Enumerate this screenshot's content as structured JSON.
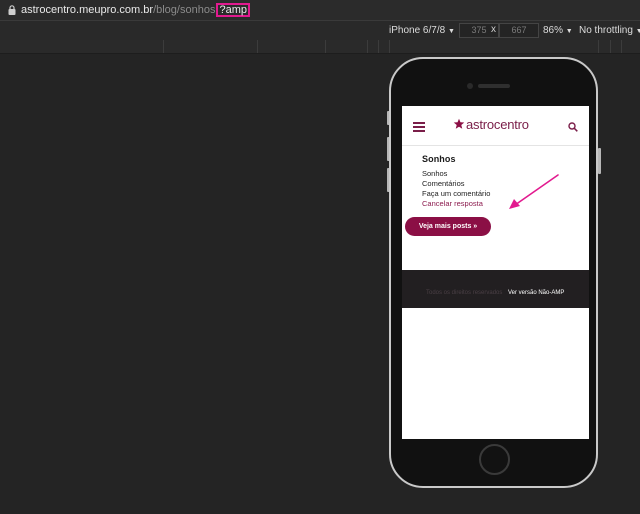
{
  "browser": {
    "url_host": "astrocentro.meupro.com.br",
    "url_path": "/blog/sonhos",
    "url_highlight": "?amp"
  },
  "device_toolbar": {
    "device": "iPhone 6/7/8",
    "width": "375",
    "height": "667",
    "separator": "x",
    "zoom": "86%",
    "throttling": "No throttling",
    "dropdown_glyph": "▼"
  },
  "site": {
    "logo_text": "astrocentro",
    "brand_color": "#7a1e49",
    "accent_color": "#e21a8f",
    "section_title": "Sonhos",
    "links": [
      "Sonhos",
      "Comentários",
      "Faça um comentário",
      "Cancelar resposta"
    ],
    "more_button": "Veja mais posts »",
    "footer_copyright": "Todos os direitos reservados",
    "footer_link": "Ver versão Não-AMP"
  },
  "icons": {
    "lock": "lock-icon",
    "menu": "hamburger-menu-icon",
    "search": "search-icon",
    "logo_star": "star-icon",
    "annotation": "arrow-annotation"
  }
}
